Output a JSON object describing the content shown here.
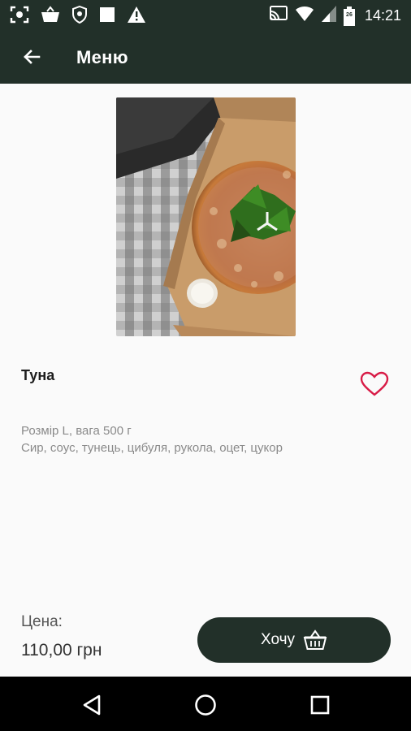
{
  "status_bar": {
    "time": "14:21",
    "battery_level": "26",
    "icons": [
      "screenshot-icon",
      "basket-icon",
      "shield-icon",
      "stop-icon",
      "warning-icon",
      "cast-icon",
      "wifi-icon",
      "signal-icon",
      "battery-icon"
    ]
  },
  "app_bar": {
    "title": "Меню",
    "back_icon": "arrow-back-icon"
  },
  "product": {
    "image": "pizza-photo",
    "name": "Туна",
    "size_weight": "Розмір L, вага 500 г",
    "ingredients": "Сир, соус, тунець, цибуля, рукола, оцет, цукор",
    "favorite_icon": "heart-outline-icon"
  },
  "footer": {
    "price_label": "Цена:",
    "price": "110,00 грн",
    "want_button_label": "Хочу",
    "want_button_icon": "basket-icon"
  },
  "nav_bar": {
    "buttons": [
      "back-triangle-icon",
      "home-circle-icon",
      "recents-square-icon"
    ]
  },
  "colors": {
    "primary_dark": "#223029",
    "favorite": "#d81b46",
    "background": "#fafafa"
  }
}
